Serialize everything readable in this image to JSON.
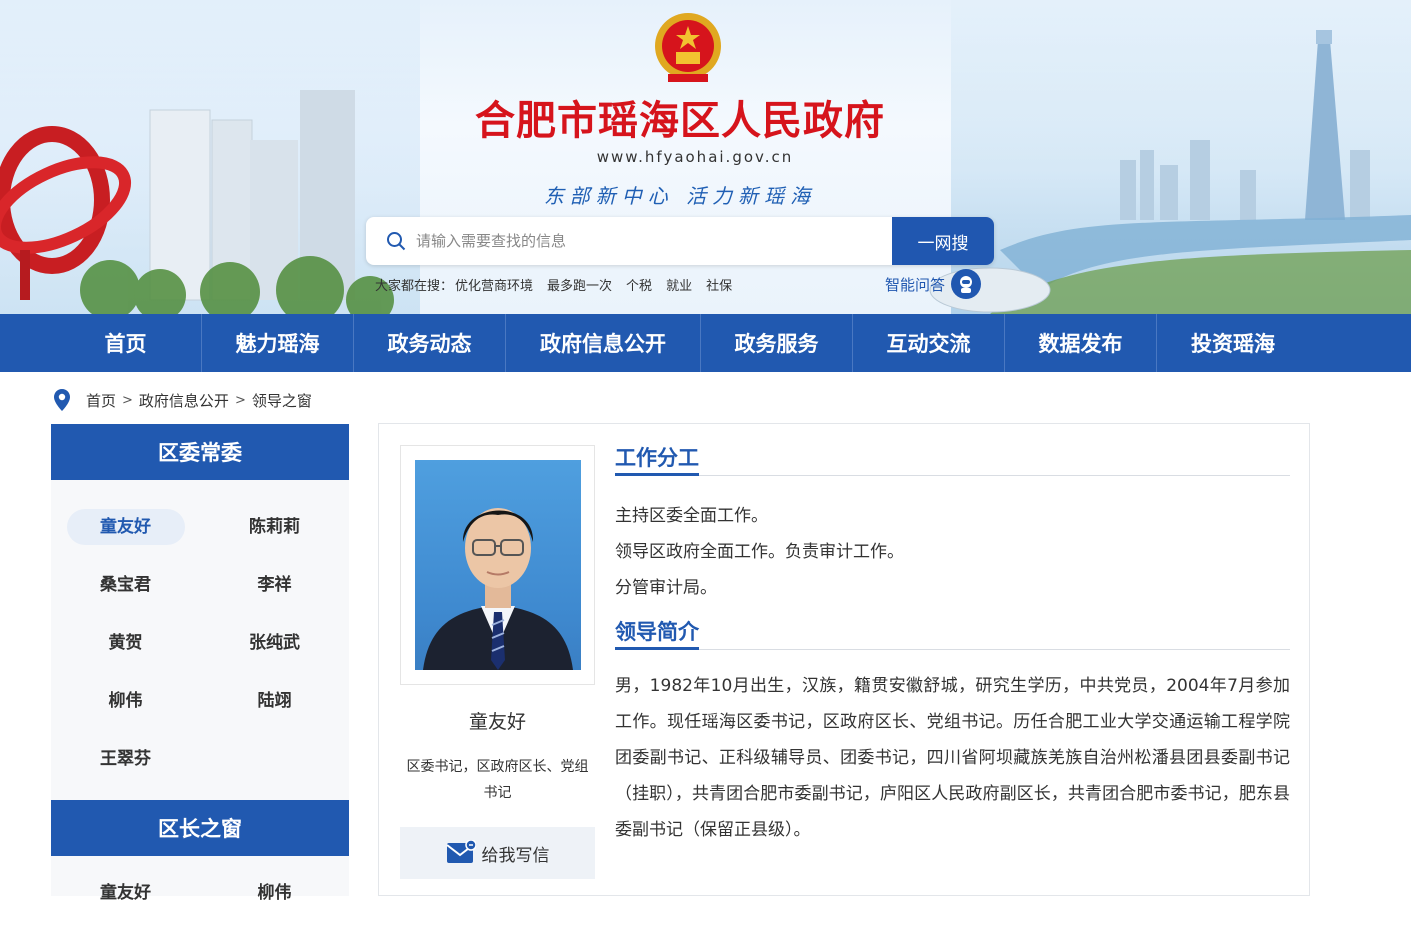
{
  "header": {
    "site_title": "合肥市瑶海区人民政府",
    "site_url": "www.hfyaohai.gov.cn",
    "slogan": "东部新中心  活力新瑶海",
    "search": {
      "placeholder": "请输入需要查找的信息",
      "button_label": "一网搜"
    },
    "hot_search": {
      "label": "大家都在搜：",
      "items": [
        "优化营商环境",
        "最多跑一次",
        "个税",
        "就业",
        "社保"
      ]
    },
    "smart_qa_label": "智能问答"
  },
  "nav": {
    "items": [
      "首页",
      "魅力瑶海",
      "政务动态",
      "政府信息公开",
      "政务服务",
      "互动交流",
      "数据发布",
      "投资瑶海"
    ]
  },
  "breadcrumb": {
    "items": [
      "首页",
      "政府信息公开",
      "领导之窗"
    ],
    "separator": ">"
  },
  "sidebar": {
    "section1": {
      "title": "区委常委",
      "members": [
        "童友好",
        "陈莉莉",
        "桑宝君",
        "李祥",
        "黄贺",
        "张纯武",
        "柳伟",
        "陆翊",
        "王翠芬"
      ],
      "active": "童友好"
    },
    "section2": {
      "title": "区长之窗",
      "members": [
        "童友好",
        "柳伟"
      ]
    }
  },
  "leader": {
    "name": "童友好",
    "title": "区委书记，区政府区长、党组书记",
    "write_label": "给我写信",
    "duty_heading": "工作分工",
    "duties": [
      "主持区委全面工作。",
      "领导区政府全面工作。负责审计工作。",
      "分管审计局。"
    ],
    "bio_heading": "领导简介",
    "bio": "男，1982年10月出生，汉族，籍贯安徽舒城，研究生学历，中共党员，2004年7月参加工作。现任瑶海区委书记，区政府区长、党组书记。历任合肥工业大学交通运输工程学院团委副书记、正科级辅导员、团委书记，四川省阿坝藏族羌族自治州松潘县团县委副书记（挂职），共青团合肥市委副书记，庐阳区人民政府副区长，共青团合肥市委书记，肥东县委副书记（保留正县级）。"
  },
  "colors": {
    "primary_blue": "#2159b0",
    "title_red": "#d6141c",
    "active_bg": "#e7eef8"
  }
}
